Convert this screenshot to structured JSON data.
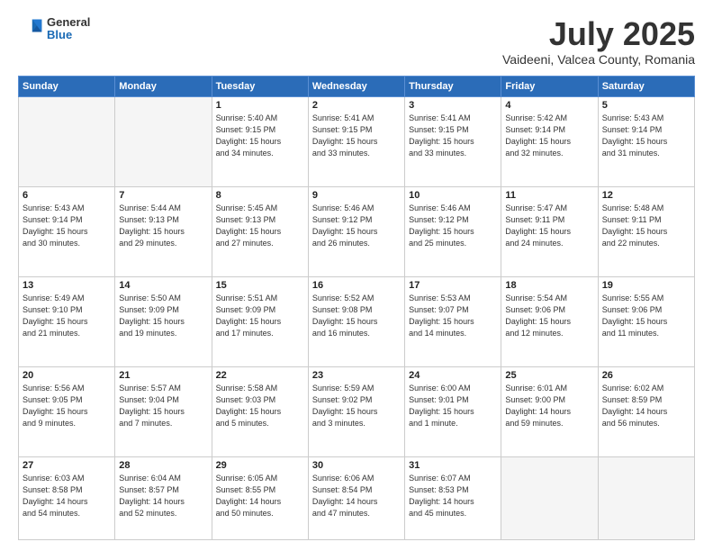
{
  "header": {
    "logo_general": "General",
    "logo_blue": "Blue",
    "month": "July 2025",
    "location": "Vaideeni, Valcea County, Romania"
  },
  "weekdays": [
    "Sunday",
    "Monday",
    "Tuesday",
    "Wednesday",
    "Thursday",
    "Friday",
    "Saturday"
  ],
  "weeks": [
    [
      {
        "day": "",
        "info": ""
      },
      {
        "day": "",
        "info": ""
      },
      {
        "day": "1",
        "info": "Sunrise: 5:40 AM\nSunset: 9:15 PM\nDaylight: 15 hours\nand 34 minutes."
      },
      {
        "day": "2",
        "info": "Sunrise: 5:41 AM\nSunset: 9:15 PM\nDaylight: 15 hours\nand 33 minutes."
      },
      {
        "day": "3",
        "info": "Sunrise: 5:41 AM\nSunset: 9:15 PM\nDaylight: 15 hours\nand 33 minutes."
      },
      {
        "day": "4",
        "info": "Sunrise: 5:42 AM\nSunset: 9:14 PM\nDaylight: 15 hours\nand 32 minutes."
      },
      {
        "day": "5",
        "info": "Sunrise: 5:43 AM\nSunset: 9:14 PM\nDaylight: 15 hours\nand 31 minutes."
      }
    ],
    [
      {
        "day": "6",
        "info": "Sunrise: 5:43 AM\nSunset: 9:14 PM\nDaylight: 15 hours\nand 30 minutes."
      },
      {
        "day": "7",
        "info": "Sunrise: 5:44 AM\nSunset: 9:13 PM\nDaylight: 15 hours\nand 29 minutes."
      },
      {
        "day": "8",
        "info": "Sunrise: 5:45 AM\nSunset: 9:13 PM\nDaylight: 15 hours\nand 27 minutes."
      },
      {
        "day": "9",
        "info": "Sunrise: 5:46 AM\nSunset: 9:12 PM\nDaylight: 15 hours\nand 26 minutes."
      },
      {
        "day": "10",
        "info": "Sunrise: 5:46 AM\nSunset: 9:12 PM\nDaylight: 15 hours\nand 25 minutes."
      },
      {
        "day": "11",
        "info": "Sunrise: 5:47 AM\nSunset: 9:11 PM\nDaylight: 15 hours\nand 24 minutes."
      },
      {
        "day": "12",
        "info": "Sunrise: 5:48 AM\nSunset: 9:11 PM\nDaylight: 15 hours\nand 22 minutes."
      }
    ],
    [
      {
        "day": "13",
        "info": "Sunrise: 5:49 AM\nSunset: 9:10 PM\nDaylight: 15 hours\nand 21 minutes."
      },
      {
        "day": "14",
        "info": "Sunrise: 5:50 AM\nSunset: 9:09 PM\nDaylight: 15 hours\nand 19 minutes."
      },
      {
        "day": "15",
        "info": "Sunrise: 5:51 AM\nSunset: 9:09 PM\nDaylight: 15 hours\nand 17 minutes."
      },
      {
        "day": "16",
        "info": "Sunrise: 5:52 AM\nSunset: 9:08 PM\nDaylight: 15 hours\nand 16 minutes."
      },
      {
        "day": "17",
        "info": "Sunrise: 5:53 AM\nSunset: 9:07 PM\nDaylight: 15 hours\nand 14 minutes."
      },
      {
        "day": "18",
        "info": "Sunrise: 5:54 AM\nSunset: 9:06 PM\nDaylight: 15 hours\nand 12 minutes."
      },
      {
        "day": "19",
        "info": "Sunrise: 5:55 AM\nSunset: 9:06 PM\nDaylight: 15 hours\nand 11 minutes."
      }
    ],
    [
      {
        "day": "20",
        "info": "Sunrise: 5:56 AM\nSunset: 9:05 PM\nDaylight: 15 hours\nand 9 minutes."
      },
      {
        "day": "21",
        "info": "Sunrise: 5:57 AM\nSunset: 9:04 PM\nDaylight: 15 hours\nand 7 minutes."
      },
      {
        "day": "22",
        "info": "Sunrise: 5:58 AM\nSunset: 9:03 PM\nDaylight: 15 hours\nand 5 minutes."
      },
      {
        "day": "23",
        "info": "Sunrise: 5:59 AM\nSunset: 9:02 PM\nDaylight: 15 hours\nand 3 minutes."
      },
      {
        "day": "24",
        "info": "Sunrise: 6:00 AM\nSunset: 9:01 PM\nDaylight: 15 hours\nand 1 minute."
      },
      {
        "day": "25",
        "info": "Sunrise: 6:01 AM\nSunset: 9:00 PM\nDaylight: 14 hours\nand 59 minutes."
      },
      {
        "day": "26",
        "info": "Sunrise: 6:02 AM\nSunset: 8:59 PM\nDaylight: 14 hours\nand 56 minutes."
      }
    ],
    [
      {
        "day": "27",
        "info": "Sunrise: 6:03 AM\nSunset: 8:58 PM\nDaylight: 14 hours\nand 54 minutes."
      },
      {
        "day": "28",
        "info": "Sunrise: 6:04 AM\nSunset: 8:57 PM\nDaylight: 14 hours\nand 52 minutes."
      },
      {
        "day": "29",
        "info": "Sunrise: 6:05 AM\nSunset: 8:55 PM\nDaylight: 14 hours\nand 50 minutes."
      },
      {
        "day": "30",
        "info": "Sunrise: 6:06 AM\nSunset: 8:54 PM\nDaylight: 14 hours\nand 47 minutes."
      },
      {
        "day": "31",
        "info": "Sunrise: 6:07 AM\nSunset: 8:53 PM\nDaylight: 14 hours\nand 45 minutes."
      },
      {
        "day": "",
        "info": ""
      },
      {
        "day": "",
        "info": ""
      }
    ]
  ]
}
